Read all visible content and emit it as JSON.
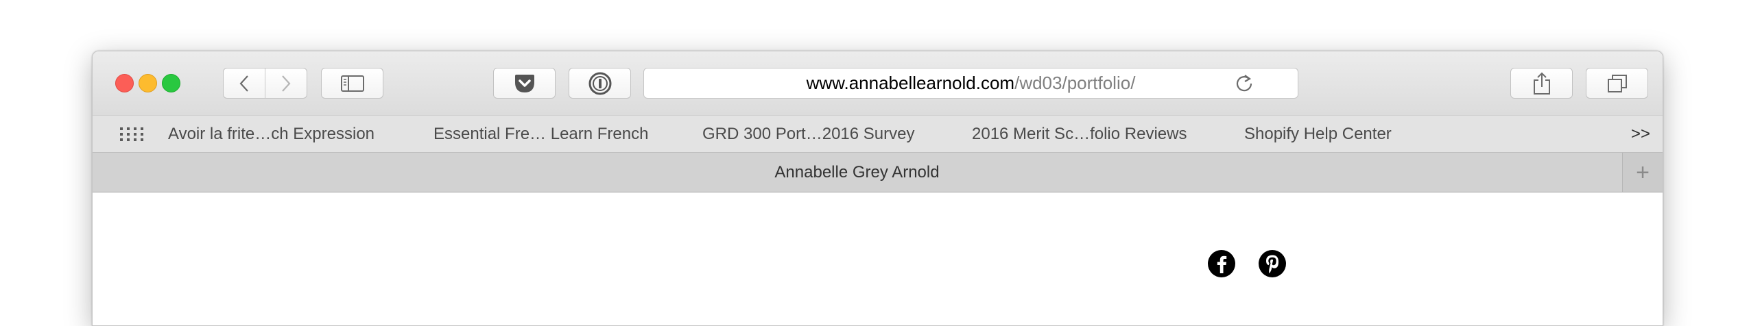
{
  "window": {
    "url": {
      "host": "www.annabellearnold.com",
      "path": "/wd03/portfolio/"
    }
  },
  "toolbar": {
    "icons": [
      "back-icon",
      "forward-icon",
      "sidebar-icon",
      "pocket-icon",
      "1password-icon",
      "reload-icon",
      "share-icon",
      "tabs-overview-icon"
    ]
  },
  "bookmarks": {
    "items": [
      "Avoir la frite…ch Expression",
      "Essential Fre… Learn French",
      "GRD 300 Port…2016 Survey",
      "2016 Merit Sc…folio Reviews",
      "Shopify Help Center"
    ],
    "overflow": ">>"
  },
  "tab": {
    "title": "Annabelle Grey Arnold",
    "new_tab": "+"
  },
  "content": {
    "social_icons": [
      "facebook-icon",
      "pinterest-icon"
    ]
  }
}
